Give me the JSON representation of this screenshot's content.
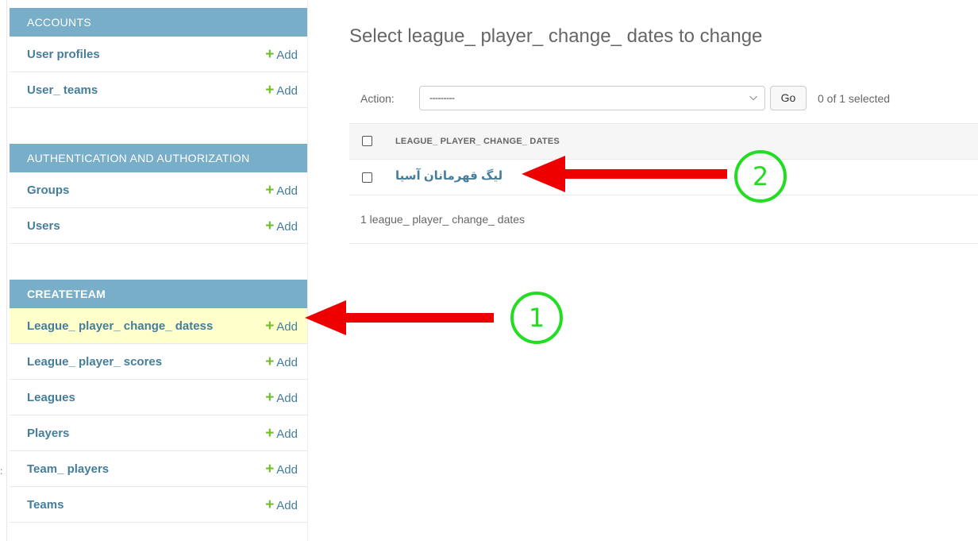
{
  "sidebar": {
    "modules": [
      {
        "caption": "ACCOUNTS",
        "rows": [
          {
            "label": "User profiles",
            "add": "Add"
          },
          {
            "label": "User_ teams",
            "add": "Add"
          }
        ]
      },
      {
        "caption": "AUTHENTICATION AND AUTHORIZATION",
        "rows": [
          {
            "label": "Groups",
            "add": "Add"
          },
          {
            "label": "Users",
            "add": "Add"
          }
        ]
      },
      {
        "caption": "CREATETEAM",
        "rows": [
          {
            "label": "League_ player_ change_ datess",
            "add": "Add",
            "selected": true
          },
          {
            "label": "League_ player_ scores",
            "add": "Add"
          },
          {
            "label": "Leagues",
            "add": "Add"
          },
          {
            "label": "Players",
            "add": "Add"
          },
          {
            "label": "Team_ players",
            "add": "Add"
          },
          {
            "label": "Teams",
            "add": "Add"
          }
        ]
      }
    ],
    "edge_mark": ":"
  },
  "main": {
    "title": "Select league_ player_ change_ dates to change",
    "actions": {
      "label": "Action:",
      "selected_value": "---------",
      "go_label": "Go",
      "selection_count": "0 of 1 selected"
    },
    "table": {
      "header": "LEAGUE_ PLAYER_ CHANGE_ DATES",
      "rows": [
        {
          "label": "لیگ قهرمانان آسیا"
        }
      ]
    },
    "paginator": "1 league_ player_ change_ dates"
  },
  "annotations": [
    {
      "number": "1"
    },
    {
      "number": "2"
    }
  ],
  "colors": {
    "module_header": "#79aec8",
    "link": "#447e9b",
    "add_plus": "#70bf2b",
    "selected_row": "#ffffcc",
    "arrow": "#ee0000",
    "circle": "#22dd22"
  }
}
